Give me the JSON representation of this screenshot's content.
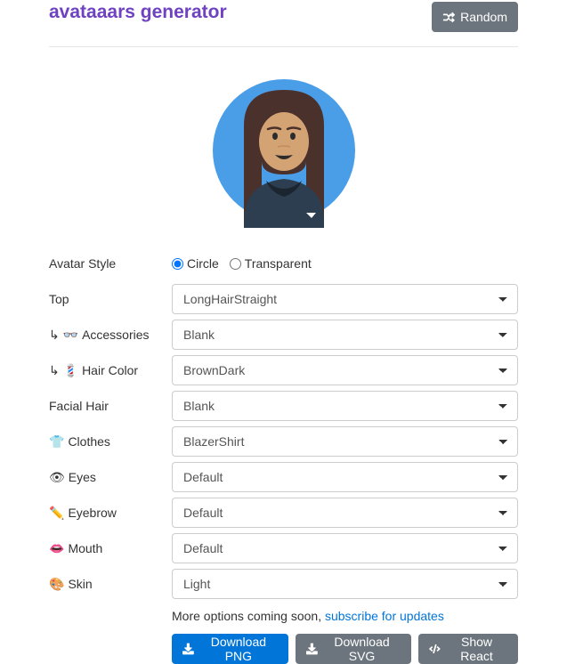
{
  "header": {
    "title": "avataaars generator",
    "random_label": "Random"
  },
  "style": {
    "label": "Avatar Style",
    "option_circle": "Circle",
    "option_transparent": "Transparent",
    "selected": "Circle"
  },
  "fields": {
    "top": {
      "label": "Top",
      "value": "LongHairStraight"
    },
    "accessories": {
      "prefix": "↳ 👓",
      "label": "Accessories",
      "value": "Blank"
    },
    "hair_color": {
      "prefix": "↳ 💈",
      "label": "Hair Color",
      "value": "BrownDark"
    },
    "facial_hair": {
      "label": "Facial Hair",
      "value": "Blank"
    },
    "clothes": {
      "prefix": "👕",
      "label": "Clothes",
      "value": "BlazerShirt"
    },
    "eyes": {
      "prefix": "👁",
      "label": "Eyes",
      "value": "Default"
    },
    "eyebrow": {
      "prefix": "✏️",
      "label": "Eyebrow",
      "value": "Default"
    },
    "mouth": {
      "prefix": "👄",
      "label": "Mouth",
      "value": "Default"
    },
    "skin": {
      "prefix": "🎨",
      "label": "Skin",
      "value": "Light"
    }
  },
  "footer": {
    "text": "More options coming soon, ",
    "link": "subscribe for updates"
  },
  "buttons": {
    "download_png": "Download PNG",
    "download_svg": "Download SVG",
    "show_react": "Show React"
  },
  "colors": {
    "accent": "#6f42c1",
    "button_primary": "#0275d8",
    "button_secondary": "#6c757d"
  }
}
